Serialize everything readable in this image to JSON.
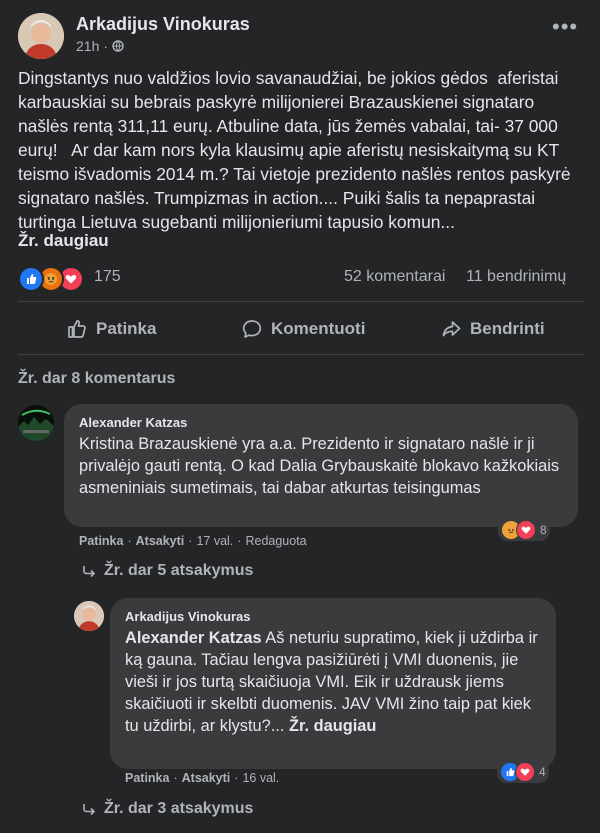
{
  "post": {
    "author": "Arkadijus Vinokuras",
    "time": "21h",
    "privacy_icon": "globe-icon",
    "text": "Dingstantys nuo valdžios lovio savanaudžiai, be jokios gėdos  aferistai karbauskiai su bebrais paskyrė milijonierei Brazauskienei signataro našlės rentą 311,11 eurų. Atbuline data, jūs žemės vabalai, tai- 37 000 eurų!   Ar dar kam nors kyla klausimų apie aferistų nesiskaitymą su KT teismo išvadomis 2014 m.? Tai vietoje prezidento našlės rentos paskyrė signataro našlės. Trumpizmas in action.... Puiki šalis ta nepaprastai turtinga Lietuva sugebanti milijonieriumi tapusio komun...",
    "see_more": "Žr. daugiau",
    "reaction_count": "175",
    "comments_count": "52 komentarai",
    "shares_count": "11 bendrinimų"
  },
  "actions": {
    "like": "Patinka",
    "comment": "Komentuoti",
    "share": "Bendrinti"
  },
  "more_comments": "Žr. dar 8 komentarus",
  "comments": [
    {
      "author": "Alexander Katzas",
      "text": "Kristina Brazauskienė yra a.a. Prezidento ir signataro našlė ir ji privalėjo gauti rentą. O kad Dalia Grybauskaitė blokavo kažkokiais asmeniniais sumetimais, tai dabar atkurtas teisingumas",
      "like": "Patinka",
      "reply": "Atsakyti",
      "time": "17 val.",
      "edited": "Redaguota",
      "reactions": "8",
      "view_replies": "Žr. dar 5 atsakymus"
    },
    {
      "author": "Arkadijus Vinokuras",
      "mention": "Alexander Katzas",
      "text": " Aš neturiu supratimo, kiek ji uždirba ir ką gauna. Tačiau lengva pasižiūrėti į VMI duonenis, jie vieši ir jos turtą skaičiuoja VMI. Eik ir uždrausk jiems skaičiuoti ir skelbti duomenis. JAV VMI žino taip pat kiek tu uždirbi, ar klystu?... ",
      "see_more": "Žr. daugiau",
      "like": "Patinka",
      "reply": "Atsakyti",
      "time": "16 val.",
      "reactions": "4",
      "view_replies": "Žr. dar 3 atsakymus"
    }
  ],
  "colors": {
    "background": "#242526",
    "bubble": "#3a3b3c",
    "like_blue": "#2078f4",
    "love_red": "#f33e58",
    "angry_orange": "#e9710f"
  }
}
